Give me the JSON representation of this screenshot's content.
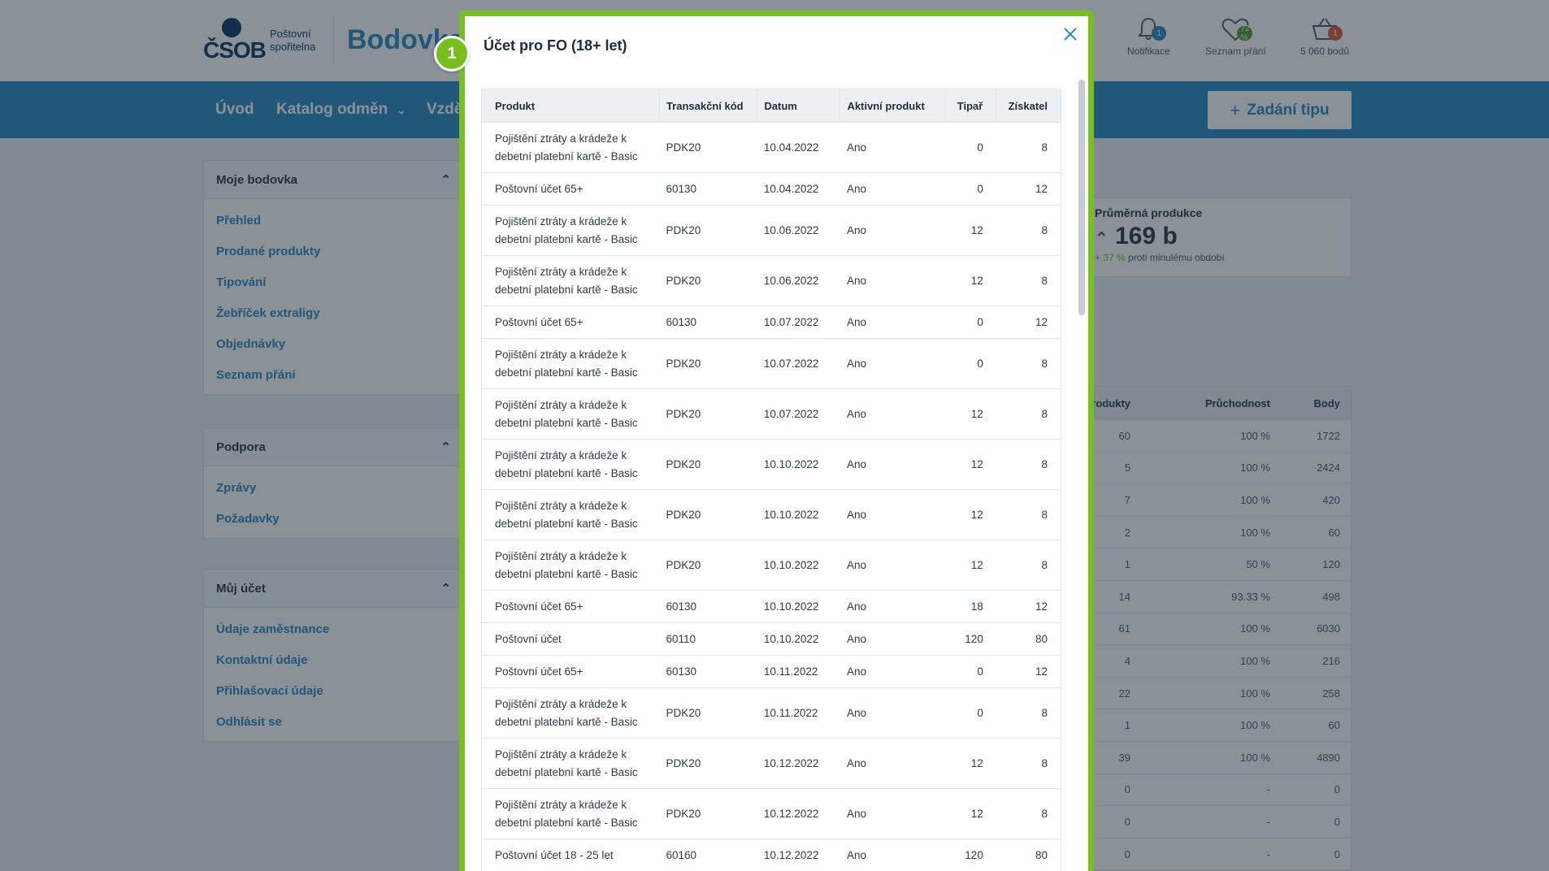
{
  "header": {
    "logo_text": "ČSOB",
    "logo_sub": "Poštovní spořitelna",
    "brand": "Bodovka",
    "notifications": {
      "label": "Notifikace",
      "badge": "1"
    },
    "wishlist": {
      "label": "Seznam přání",
      "badge": "72 %"
    },
    "cart": {
      "label": "5 060 bodů",
      "badge": "1"
    }
  },
  "nav": {
    "items": [
      "Úvod",
      "Katalog odměn",
      "Vzdě"
    ],
    "tip_button": "Zadání tipu"
  },
  "sidebar": {
    "sections": [
      {
        "title": "Moje bodovka",
        "links": [
          "Přehled",
          "Prodané produkty",
          "Tipování",
          "Žebříček extraligy",
          "Objednávky",
          "Seznam přání"
        ]
      },
      {
        "title": "Podpora",
        "links": [
          "Zprávy",
          "Požadavky"
        ]
      },
      {
        "title": "Můj účet",
        "links": [
          "Údaje zaměstnance",
          "Kontaktní údaje",
          "Přihlašovací údaje",
          "Odhlásit se"
        ]
      }
    ]
  },
  "stat": {
    "label": "Průměrná produkce",
    "value": "169 b",
    "change": "+ 37 %",
    "note": "proti minulému období"
  },
  "bg_table": {
    "headers": [
      "rodukty",
      "Průchodnost",
      "Body"
    ],
    "rows": [
      [
        "60",
        "100 %",
        "1722"
      ],
      [
        "5",
        "100 %",
        "2424"
      ],
      [
        "7",
        "100 %",
        "420"
      ],
      [
        "2",
        "100 %",
        "60"
      ],
      [
        "1",
        "50 %",
        "120"
      ],
      [
        "14",
        "93.33 %",
        "498"
      ],
      [
        "61",
        "100 %",
        "6030"
      ],
      [
        "4",
        "100 %",
        "216"
      ],
      [
        "22",
        "100 %",
        "258"
      ],
      [
        "1",
        "100 %",
        "60"
      ],
      [
        "39",
        "100 %",
        "4890"
      ],
      [
        "0",
        "-",
        "0"
      ],
      [
        "0",
        "-",
        "0"
      ],
      [
        "0",
        "-",
        "0"
      ]
    ]
  },
  "modal": {
    "title": "Účet pro FO (18+ let)",
    "step": "1",
    "columns": [
      "Produkt",
      "Transakční kód",
      "Datum",
      "Aktivní produkt",
      "Tipař",
      "Získatel"
    ],
    "rows": [
      [
        "Pojištění ztráty a krádeže k debetní platební kartě - Basic",
        "PDK20",
        "10.04.2022",
        "Ano",
        "0",
        "8"
      ],
      [
        "Poštovní účet 65+",
        "60130",
        "10.04.2022",
        "Ano",
        "0",
        "12"
      ],
      [
        "Pojištění ztráty a krádeže k debetní platební kartě - Basic",
        "PDK20",
        "10.06.2022",
        "Ano",
        "12",
        "8"
      ],
      [
        "Pojištění ztráty a krádeže k debetní platební kartě - Basic",
        "PDK20",
        "10.06.2022",
        "Ano",
        "12",
        "8"
      ],
      [
        "Poštovní účet 65+",
        "60130",
        "10.07.2022",
        "Ano",
        "0",
        "12"
      ],
      [
        "Pojištění ztráty a krádeže k debetní platební kartě - Basic",
        "PDK20",
        "10.07.2022",
        "Ano",
        "0",
        "8"
      ],
      [
        "Pojištění ztráty a krádeže k debetní platební kartě - Basic",
        "PDK20",
        "10.07.2022",
        "Ano",
        "12",
        "8"
      ],
      [
        "Pojištění ztráty a krádeže k debetní platební kartě - Basic",
        "PDK20",
        "10.10.2022",
        "Ano",
        "12",
        "8"
      ],
      [
        "Pojištění ztráty a krádeže k debetní platební kartě - Basic",
        "PDK20",
        "10.10.2022",
        "Ano",
        "12",
        "8"
      ],
      [
        "Pojištění ztráty a krádeže k debetní platební kartě - Basic",
        "PDK20",
        "10.10.2022",
        "Ano",
        "12",
        "8"
      ],
      [
        "Poštovní účet 65+",
        "60130",
        "10.10.2022",
        "Ano",
        "18",
        "12"
      ],
      [
        "Poštovní účet",
        "60110",
        "10.10.2022",
        "Ano",
        "120",
        "80"
      ],
      [
        "Poštovní účet 65+",
        "60130",
        "10.11.2022",
        "Ano",
        "0",
        "12"
      ],
      [
        "Pojištění ztráty a krádeže k debetní platební kartě - Basic",
        "PDK20",
        "10.11.2022",
        "Ano",
        "0",
        "8"
      ],
      [
        "Pojištění ztráty a krádeže k debetní platební kartě - Basic",
        "PDK20",
        "10.12.2022",
        "Ano",
        "12",
        "8"
      ],
      [
        "Pojištění ztráty a krádeže k debetní platební kartě - Basic",
        "PDK20",
        "10.12.2022",
        "Ano",
        "12",
        "8"
      ],
      [
        "Poštovní účet 18 - 25 let",
        "60160",
        "10.12.2022",
        "Ano",
        "120",
        "80"
      ]
    ]
  },
  "colors": {
    "accent": "#78be20",
    "primary": "#2d8ac0",
    "brand_dark": "#0d3b66",
    "badge_blue": "#2d8ac0",
    "badge_red": "#e0543a"
  }
}
